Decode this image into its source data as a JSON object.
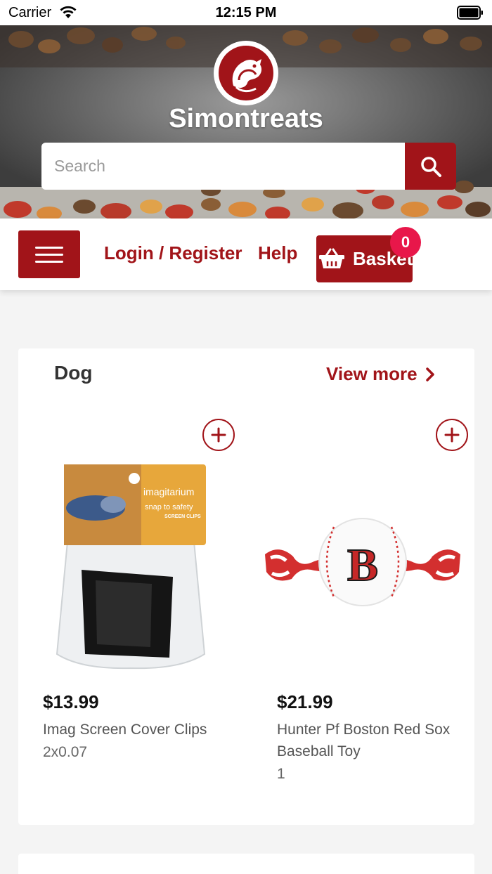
{
  "status_bar": {
    "carrier": "Carrier",
    "time": "12:15 PM"
  },
  "header": {
    "brand": "Simontreats",
    "search": {
      "placeholder": "Search",
      "value": ""
    }
  },
  "nav": {
    "login_label": "Login / Register",
    "help_label": "Help",
    "basket_label": "Basket",
    "basket_count": "0"
  },
  "category": {
    "title": "Dog",
    "view_more_label": "View more",
    "products": [
      {
        "price": "$13.99",
        "name": "Imag Screen Cover Clips",
        "meta": "2x0.07",
        "image_icon": "screen-clips-package",
        "image_text_brand": "imagitarium",
        "image_text_tagline": "snap to safety",
        "image_text_sub": "SCREEN CLIPS"
      },
      {
        "price": "$21.99",
        "name": "Hunter Pf Boston Red Sox Baseball Toy",
        "meta": "1",
        "image_icon": "baseball-rope-toy",
        "image_text_letter": "B"
      }
    ]
  },
  "colors": {
    "brand": "#a11419",
    "badge": "#e8174a",
    "background": "#f4f4f4"
  }
}
